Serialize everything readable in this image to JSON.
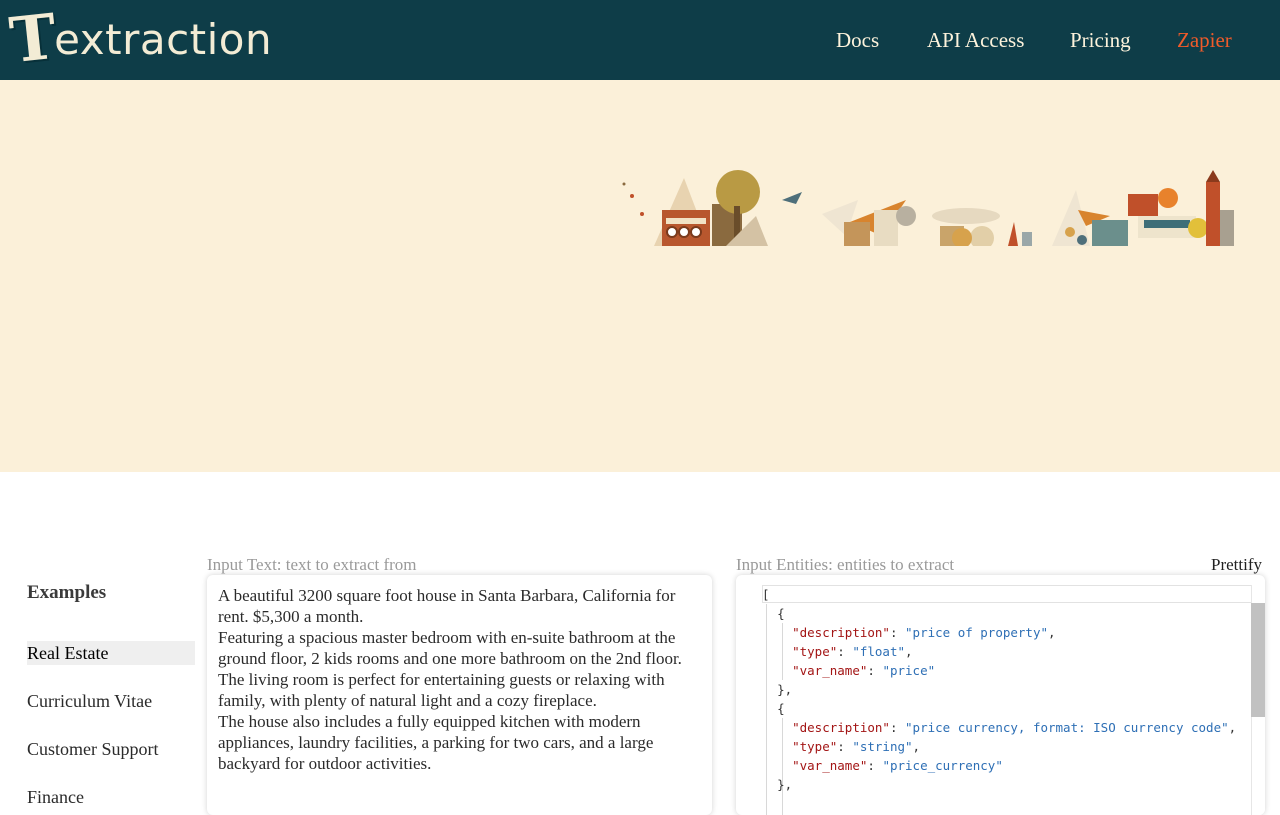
{
  "header": {
    "logo_first": "T",
    "logo_rest": "extraction",
    "nav": {
      "docs": "Docs",
      "api": "API Access",
      "pricing": "Pricing",
      "zapier": "Zapier"
    },
    "colors": {
      "bar": "#0e3d48",
      "accent": "#f05b2a"
    }
  },
  "hero": {
    "background": "#fbf0d9",
    "illustration": "paper-collage-illustration"
  },
  "examples": {
    "title": "Examples",
    "items": [
      "Real Estate",
      "Curriculum Vitae",
      "Customer Support",
      "Finance"
    ],
    "selected": "Real Estate"
  },
  "input_text": {
    "label": "Input Text: text to extract from",
    "paragraphs": [
      "A beautiful 3200 square foot house in Santa Barbara, California for rent. $5,300 a month.",
      "Featuring a spacious master bedroom with en-suite bathroom at the ground floor, 2 kids rooms and one more bathroom on the 2nd floor.",
      "The living room is perfect for entertaining guests or relaxing with family, with plenty of natural light and a cozy fireplace.",
      "The house also includes a fully equipped kitchen with modern appliances, laundry facilities, a parking for two cars, and a large backyard for outdoor activities."
    ]
  },
  "input_entities": {
    "label": "Input Entities: entities to extract",
    "prettify_label": "Prettify",
    "json": {
      "open_bracket": "[",
      "open_brace": "{",
      "close_brace_comma": "},",
      "e1": {
        "k_description": "\"description\"",
        "v_description": "\"price of property\"",
        "k_type": "\"type\"",
        "v_type": "\"float\"",
        "k_var": "\"var_name\"",
        "v_var": "\"price\""
      },
      "e2": {
        "k_description": "\"description\"",
        "v_description": "\"price currency, format: ISO currency code\"",
        "k_type": "\"type\"",
        "v_type": "\"string\"",
        "k_var": "\"var_name\"",
        "v_var": "\"price_currency\""
      }
    }
  }
}
